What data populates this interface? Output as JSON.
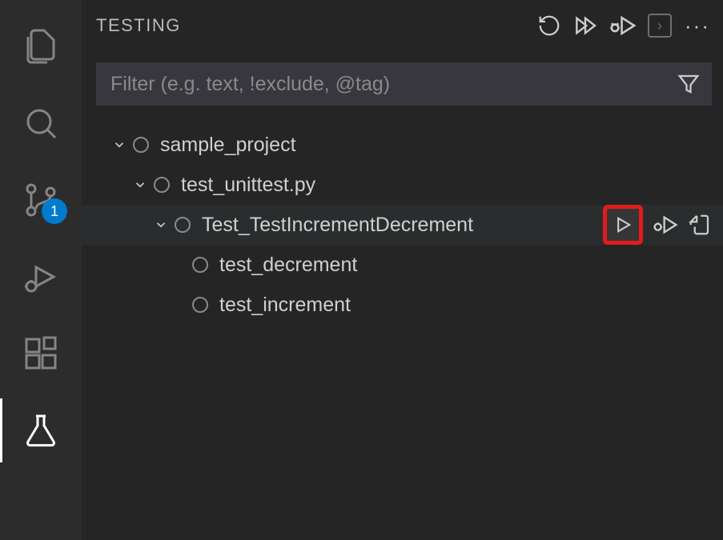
{
  "header": {
    "title": "TESTING"
  },
  "filter": {
    "placeholder": "Filter (e.g. text, !exclude, @tag)"
  },
  "sourceControl": {
    "badge": "1"
  },
  "tree": {
    "root": {
      "label": "sample_project"
    },
    "file": {
      "label": "test_unittest.py"
    },
    "class": {
      "label": "Test_TestIncrementDecrement"
    },
    "test1": {
      "label": "test_decrement"
    },
    "test2": {
      "label": "test_increment"
    }
  }
}
